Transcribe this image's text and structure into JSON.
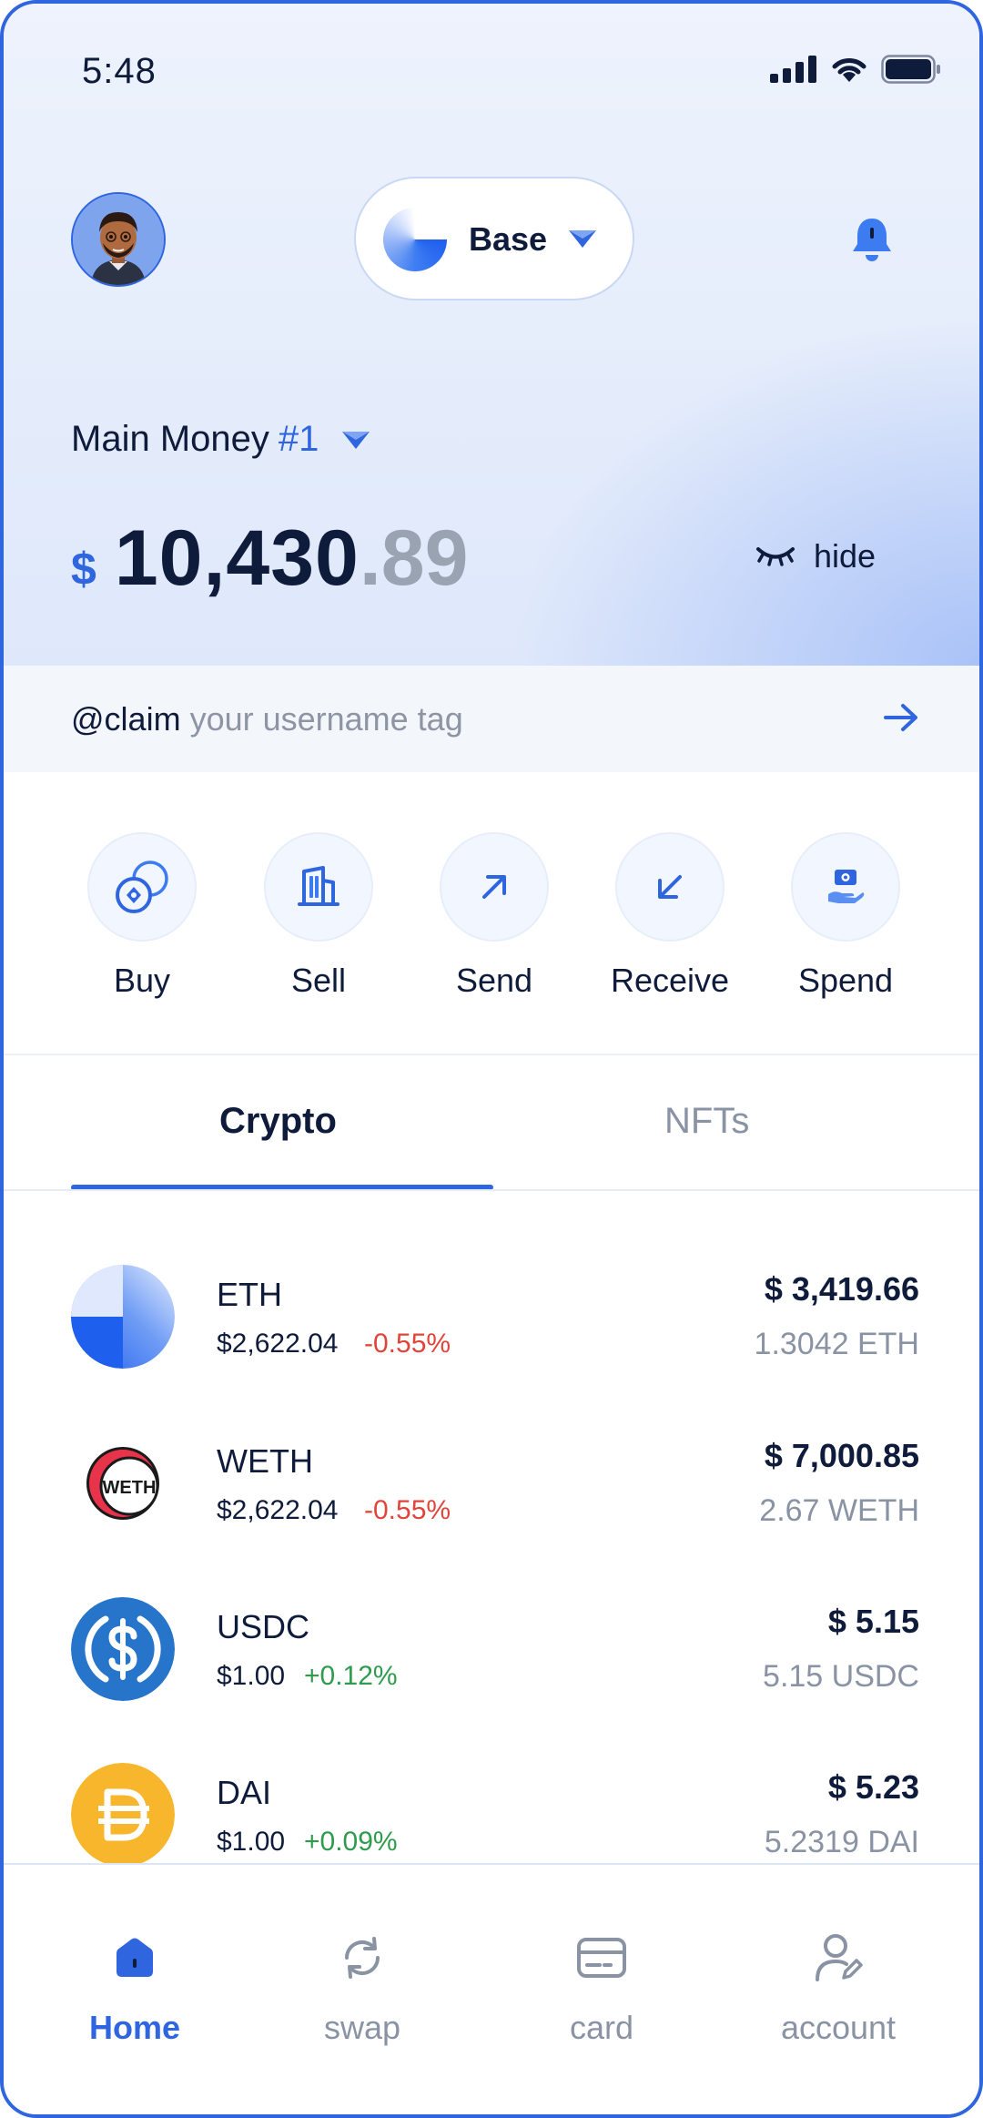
{
  "status_bar": {
    "time": "5:48"
  },
  "header": {
    "network": {
      "name": "Base"
    }
  },
  "account": {
    "name": "Main Money",
    "number": "#1",
    "balance": {
      "currency": "$",
      "integer": "10,430",
      "decimal": ".89"
    },
    "hide_label": "hide"
  },
  "claim": {
    "handle": "@claim",
    "text": " your username tag"
  },
  "actions": [
    {
      "label": "Buy",
      "icon": "coins-icon"
    },
    {
      "label": "Sell",
      "icon": "building-icon"
    },
    {
      "label": "Send",
      "icon": "arrow-up-right-icon"
    },
    {
      "label": "Receive",
      "icon": "arrow-down-left-icon"
    },
    {
      "label": "Spend",
      "icon": "hand-card-icon"
    }
  ],
  "tabs": [
    {
      "label": "Crypto",
      "active": true
    },
    {
      "label": "NFTs",
      "active": false
    }
  ],
  "tokens": [
    {
      "symbol": "ETH",
      "price": "$2,622.04",
      "change": "-0.55%",
      "value": "$ 3,419.66",
      "amount": "1.3042 ETH"
    },
    {
      "symbol": "WETH",
      "price": "$2,622.04",
      "change": "-0.55%",
      "value": "$ 7,000.85",
      "amount": "2.67 WETH",
      "logo_text": "WETH"
    },
    {
      "symbol": "USDC",
      "price": "$1.00",
      "change": "+0.12%",
      "value": "$ 5.15",
      "amount": "5.15 USDC"
    },
    {
      "symbol": "DAI",
      "price": "$1.00",
      "change": "+0.09%",
      "value": "$ 5.23",
      "amount": "5.2319 DAI"
    }
  ],
  "bottom_nav": [
    {
      "label": "Home",
      "icon": "home-icon",
      "active": true
    },
    {
      "label": "swap",
      "icon": "swap-icon",
      "active": false
    },
    {
      "label": "card",
      "icon": "card-icon",
      "active": false
    },
    {
      "label": "account",
      "icon": "account-icon",
      "active": false
    }
  ],
  "colors": {
    "accent": "#2f66e0",
    "negative": "#e0443a",
    "positive": "#2e9b4d",
    "text": "#0f1b3a",
    "muted": "#8a93a4"
  }
}
